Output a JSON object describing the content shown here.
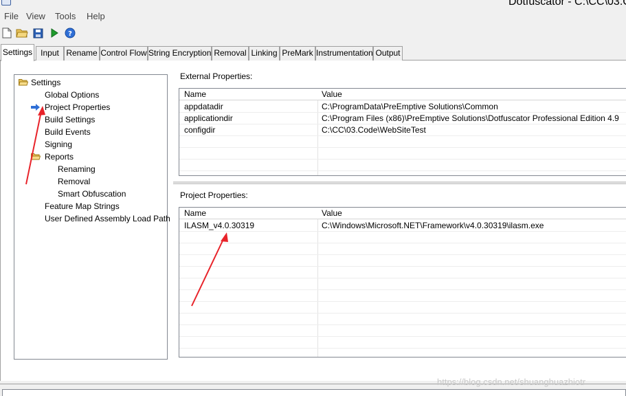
{
  "window": {
    "title": "Dotfuscator - C:\\CC\\03.C"
  },
  "menu": [
    "File",
    "View",
    "Tools",
    "Help"
  ],
  "toolbar": {
    "icons": [
      "new-file-icon",
      "open-folder-icon",
      "save-icon",
      "run-icon",
      "help-icon"
    ]
  },
  "tabs": [
    "Settings",
    "Input",
    "Rename",
    "Control Flow",
    "String Encryption",
    "Removal",
    "Linking",
    "PreMark",
    "Instrumentation",
    "Output"
  ],
  "active_tab": "Settings",
  "tree": {
    "root": "Settings",
    "items": [
      "Global Options",
      "Project Properties",
      "Build Settings",
      "Build Events",
      "Signing",
      "Reports",
      "Renaming",
      "Removal",
      "Smart Obfuscation",
      "Feature Map Strings",
      "User Defined Assembly Load Path"
    ],
    "selected": "Project Properties"
  },
  "external": {
    "label": "External Properties:",
    "columns": [
      "Name",
      "Value"
    ],
    "rows": [
      [
        "appdatadir",
        "C:\\ProgramData\\PreEmptive Solutions\\Common"
      ],
      [
        "applicationdir",
        "C:\\Program Files (x86)\\PreEmptive Solutions\\Dotfuscator Professional Edition 4.9"
      ],
      [
        "configdir",
        "C:\\CC\\03.Code\\WebSiteTest"
      ]
    ]
  },
  "project": {
    "label": "Project Properties:",
    "columns": [
      "Name",
      "Value"
    ],
    "rows": [
      [
        "ILASM_v4.0.30319",
        "C:\\Windows\\Microsoft.NET\\Framework\\v4.0.30319\\ilasm.exe"
      ]
    ]
  },
  "watermark": "https://blog.csdn.net/shuanghuazhiotr",
  "colors": {
    "arrow": "#e8232a",
    "selection_marker": "#2f6fd6",
    "folder": "#e8c25a"
  }
}
